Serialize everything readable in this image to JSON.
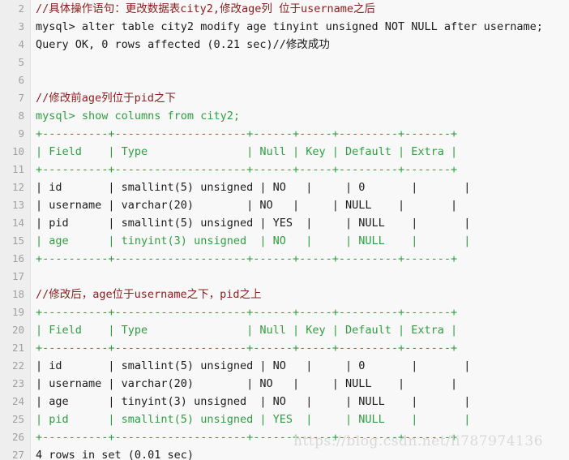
{
  "editor": {
    "background_color": "#f8f8f8",
    "gutter_color": "#eeeeee",
    "line_number_color": "#a0a0a0",
    "first_line_number": 2,
    "colors": {
      "comment": "#8b2020",
      "plain": "#1b1b1b",
      "highlight_green": "#2f9e41"
    }
  },
  "watermark": {
    "text": "https://blog.csdn.net/li787974136",
    "color": "#d9d9d9"
  },
  "lines": [
    {
      "number": "2",
      "text": "//具体操作语句：更改数据表city2,修改age列 位于username之后",
      "style": "tok-comment"
    },
    {
      "number": "3",
      "text": "mysql> alter table city2 modify age tinyint unsigned NOT NULL after username;",
      "style": "tok-plain"
    },
    {
      "number": "4",
      "text": "Query OK, 0 rows affected (0.21 sec)//修改成功",
      "style": "tok-plain"
    },
    {
      "number": "5",
      "text": "",
      "style": "tok-plain"
    },
    {
      "number": "6",
      "text": "",
      "style": "tok-plain"
    },
    {
      "number": "7",
      "text": "//修改前age列位于pid之下",
      "style": "tok-comment"
    },
    {
      "number": "8",
      "text": "mysql> show columns from city2;",
      "style": "tok-green"
    },
    {
      "number": "9",
      "text": "+----------+--------------------+------+-----+---------+-------+",
      "style": "tok-green"
    },
    {
      "number": "10",
      "text": "| Field    | Type               | Null | Key | Default | Extra |",
      "style": "tok-green"
    },
    {
      "number": "11",
      "text": "+----------+--------------------+------+-----+---------+-------+",
      "style": "tok-green"
    },
    {
      "number": "12",
      "text": "| id       | smallint(5) unsigned | NO   |     | 0       |       |",
      "style": "tok-plain"
    },
    {
      "number": "13",
      "text": "| username | varchar(20)        | NO   |     | NULL    |       |",
      "style": "tok-plain"
    },
    {
      "number": "14",
      "text": "| pid      | smallint(5) unsigned | YES  |     | NULL    |       |",
      "style": "tok-plain"
    },
    {
      "number": "15",
      "text": "| age      | tinyint(3) unsigned  | NO   |     | NULL    |       |",
      "style": "tok-green"
    },
    {
      "number": "16",
      "text": "+----------+--------------------+------+-----+---------+-------+",
      "style": "tok-green"
    },
    {
      "number": "17",
      "text": "",
      "style": "tok-plain"
    },
    {
      "number": "18",
      "text": "//修改后，age位于username之下，pid之上",
      "style": "tok-comment"
    },
    {
      "number": "19",
      "text": "+----------+--------------------+------+-----+---------+-------+",
      "style": "tok-green"
    },
    {
      "number": "20",
      "text": "| Field    | Type               | Null | Key | Default | Extra |",
      "style": "tok-green"
    },
    {
      "number": "21",
      "text": "+----------+--------------------+------+-----+---------+-------+",
      "style": "tok-green"
    },
    {
      "number": "22",
      "text": "| id       | smallint(5) unsigned | NO   |     | 0       |       |",
      "style": "tok-plain"
    },
    {
      "number": "23",
      "text": "| username | varchar(20)        | NO   |     | NULL    |       |",
      "style": "tok-plain"
    },
    {
      "number": "24",
      "text": "| age      | tinyint(3) unsigned  | NO   |     | NULL    |       |",
      "style": "tok-plain"
    },
    {
      "number": "25",
      "text": "| pid      | smallint(5) unsigned | YES  |     | NULL    |       |",
      "style": "tok-green"
    },
    {
      "number": "26",
      "text": "+----------+--------------------+------+-----+---------+-------+",
      "style": "tok-green"
    },
    {
      "number": "27",
      "text": "4 rows in set (0.01 sec)",
      "style": "tok-plain"
    }
  ],
  "sql_results": {
    "before_change": {
      "query": "show columns from city2;",
      "columns": [
        "Field",
        "Type",
        "Null",
        "Key",
        "Default",
        "Extra"
      ],
      "rows": [
        [
          "id",
          "smallint(5) unsigned",
          "NO",
          "",
          "0",
          ""
        ],
        [
          "username",
          "varchar(20)",
          "NO",
          "",
          "NULL",
          ""
        ],
        [
          "pid",
          "smallint(5) unsigned",
          "YES",
          "",
          "NULL",
          ""
        ],
        [
          "age",
          "tinyint(3) unsigned",
          "NO",
          "",
          "NULL",
          ""
        ]
      ]
    },
    "after_change": {
      "columns": [
        "Field",
        "Type",
        "Null",
        "Key",
        "Default",
        "Extra"
      ],
      "rows": [
        [
          "id",
          "smallint(5) unsigned",
          "NO",
          "",
          "0",
          ""
        ],
        [
          "username",
          "varchar(20)",
          "NO",
          "",
          "NULL",
          ""
        ],
        [
          "age",
          "tinyint(3) unsigned",
          "NO",
          "",
          "NULL",
          ""
        ],
        [
          "pid",
          "smallint(5) unsigned",
          "YES",
          "",
          "NULL",
          ""
        ]
      ],
      "row_count_text": "4 rows in set (0.01 sec)"
    },
    "alter_statement": "alter table city2 modify age tinyint unsigned NOT NULL after username;",
    "alter_result": "Query OK, 0 rows affected (0.21 sec)"
  }
}
